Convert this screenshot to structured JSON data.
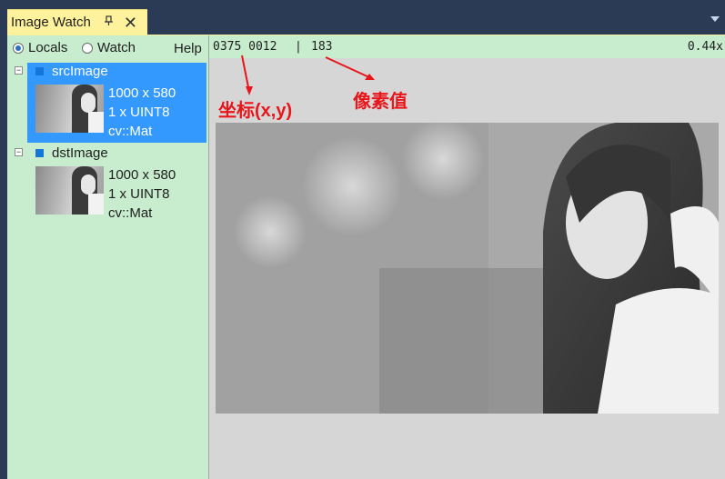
{
  "window": {
    "tab_title": "Image Watch",
    "pin_icon": "pin-icon",
    "close_icon": "close-icon",
    "menu_icon": "chevron-down-icon"
  },
  "left_pane": {
    "radios": [
      {
        "label": "Locals",
        "selected": true
      },
      {
        "label": "Watch",
        "selected": false
      }
    ],
    "help_label": "Help",
    "variables": [
      {
        "name": "srcImage",
        "size": "1000 x 580",
        "channels": "1 x UINT8",
        "type": "cv::Mat",
        "selected": true
      },
      {
        "name": "dstImage",
        "size": "1000 x 580",
        "channels": "1 x UINT8",
        "type": "cv::Mat",
        "selected": false
      }
    ]
  },
  "info_bar": {
    "coord_x": "0375",
    "coord_y": "0012",
    "separator": "|",
    "pixel_value": "183",
    "zoom": "0.44x"
  },
  "annotations": {
    "coord_label": "坐标(x,y)",
    "pixel_label": "像素值",
    "color": "#e8161b"
  },
  "colors": {
    "frame": "#2b3a55",
    "tab_active": "#fff29d",
    "pane_green": "#c8ecce",
    "selection": "#3399ff",
    "canvas_gray": "#d6d6d6"
  }
}
